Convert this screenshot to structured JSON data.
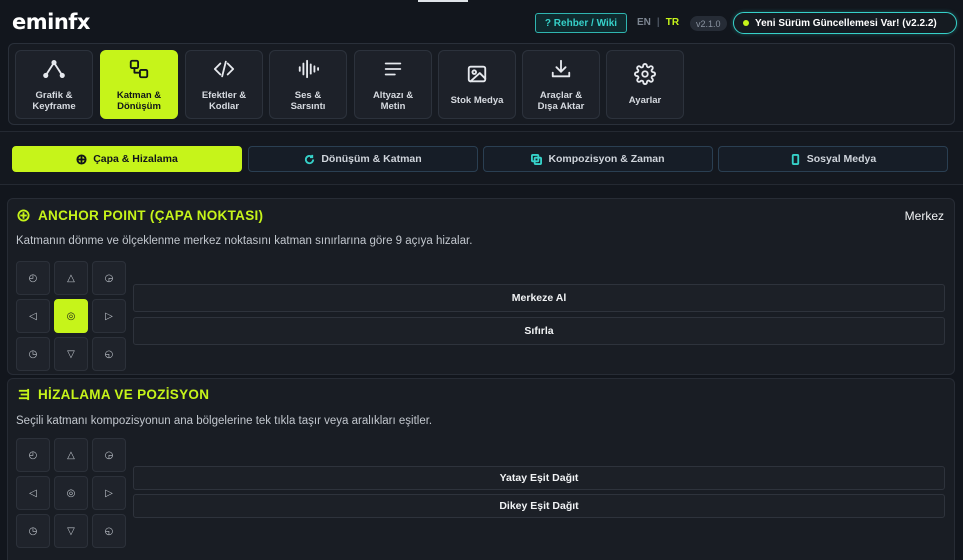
{
  "header": {
    "logo": "eminfx",
    "wiki_label": "? Rehber / Wiki",
    "lang_en": "EN",
    "lang_sep": "|",
    "lang_tr": "TR",
    "version": "v2.1.0",
    "update_label": "Yeni Sürüm Güncellemesi Var! (v2.2.2)"
  },
  "categories": [
    {
      "label": "Grafik &\nKeyframe",
      "icon": "graph-icon"
    },
    {
      "label": "Katman &\nDönüşüm",
      "icon": "layers-icon"
    },
    {
      "label": "Efektler &\nKodlar",
      "icon": "code-icon"
    },
    {
      "label": "Ses &\nSarsıntı",
      "icon": "waveform-icon"
    },
    {
      "label": "Altyazı &\nMetin",
      "icon": "text-lines-icon"
    },
    {
      "label": "Stok Medya",
      "icon": "image-icon"
    },
    {
      "label": "Araçlar &\nDışa Aktar",
      "icon": "download-icon"
    },
    {
      "label": "Ayarlar",
      "icon": "gear-icon"
    }
  ],
  "active_category": 1,
  "subtabs": [
    {
      "label": "Çapa & Hizalama",
      "icon": "crosshair-icon"
    },
    {
      "label": "Dönüşüm & Katman",
      "icon": "refresh-icon"
    },
    {
      "label": "Kompozisyon & Zaman",
      "icon": "copy-icon"
    },
    {
      "label": "Sosyal Medya",
      "icon": "phone-icon"
    }
  ],
  "active_subtab": 0,
  "anchor": {
    "title": "ANCHOR POINT (ÇAPA NOKTASI)",
    "current": "Merkez",
    "description": "Katmanın dönme ve ölçeklenme merkez noktasını katman sınırlarına göre 9 açıya hizalar.",
    "grid": [
      "◴",
      "△",
      "◶",
      "◁",
      "◎",
      "▷",
      "◷",
      "▽",
      "◵"
    ],
    "active_cell": 4,
    "center_button": "Merkeze Al",
    "reset_button": "Sıfırla"
  },
  "align": {
    "title": "HİZALAMA VE POZİSYON",
    "description": "Seçili katmanı kompozisyonun ana bölgelerine tek tıkla taşır veya aralıkları eşitler.",
    "grid": [
      "◴",
      "△",
      "◶",
      "◁",
      "◎",
      "▷",
      "◷",
      "▽",
      "◵"
    ],
    "h_distribute": "Yatay Eşit Dağıt",
    "v_distribute": "Dikey Eşit Dağıt"
  },
  "colors": {
    "accent": "#c6f41a",
    "teal": "#36d1c9",
    "background": "#12161d"
  }
}
